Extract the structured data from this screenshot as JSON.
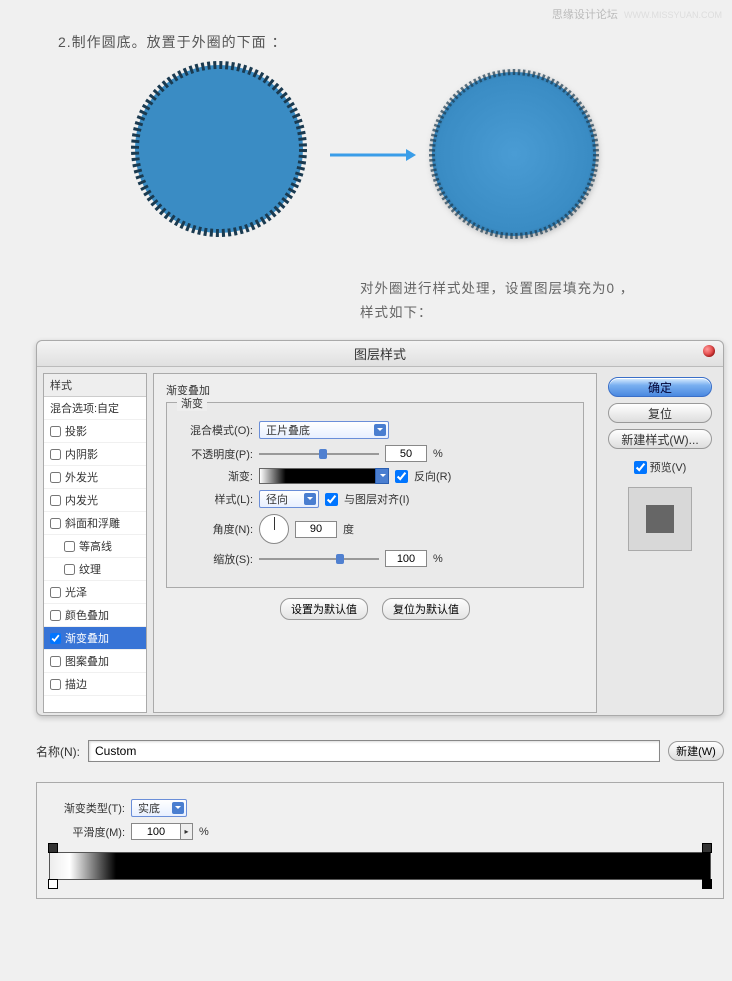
{
  "watermark": {
    "site": "思缘设计论坛",
    "url": "WWW.MISSYUAN.COM"
  },
  "step": "2.制作圆底。放置于外圈的下面 ：",
  "desc_line1": "对外圈进行样式处理，设置图层填充为0 ，",
  "desc_line2": "样式如下：",
  "dialog": {
    "title": "图层样式",
    "style_header": "样式",
    "blend_options": "混合选项:自定",
    "items": {
      "drop_shadow": "投影",
      "inner_shadow": "内阴影",
      "outer_glow": "外发光",
      "inner_glow": "内发光",
      "bevel": "斜面和浮雕",
      "contour": "等高线",
      "texture": "纹理",
      "satin": "光泽",
      "color_overlay": "颜色叠加",
      "gradient_overlay": "渐变叠加",
      "pattern_overlay": "图案叠加",
      "stroke": "描边"
    },
    "panel": {
      "section_title": "渐变叠加",
      "fieldset_label": "渐变",
      "blend_mode_label": "混合模式(O):",
      "blend_mode_value": "正片叠底",
      "opacity_label": "不透明度(P):",
      "opacity_value": "50",
      "percent": "%",
      "gradient_label": "渐变:",
      "reverse_label": "反向(R)",
      "style_label": "样式(L):",
      "style_value": "径向",
      "align_label": "与图层对齐(I)",
      "angle_label": "角度(N):",
      "angle_value": "90",
      "degree": "度",
      "scale_label": "缩放(S):",
      "scale_value": "100",
      "set_default": "设置为默认值",
      "reset_default": "复位为默认值"
    },
    "buttons": {
      "ok": "确定",
      "reset": "复位",
      "new_style": "新建样式(W)...",
      "preview": "预览(V)"
    }
  },
  "name_row": {
    "label": "名称(N):",
    "value": "Custom",
    "new_btn": "新建(W)"
  },
  "grad_editor": {
    "type_label": "渐变类型(T):",
    "type_value": "实底",
    "smooth_label": "平滑度(M):",
    "smooth_value": "100",
    "percent": "%"
  }
}
